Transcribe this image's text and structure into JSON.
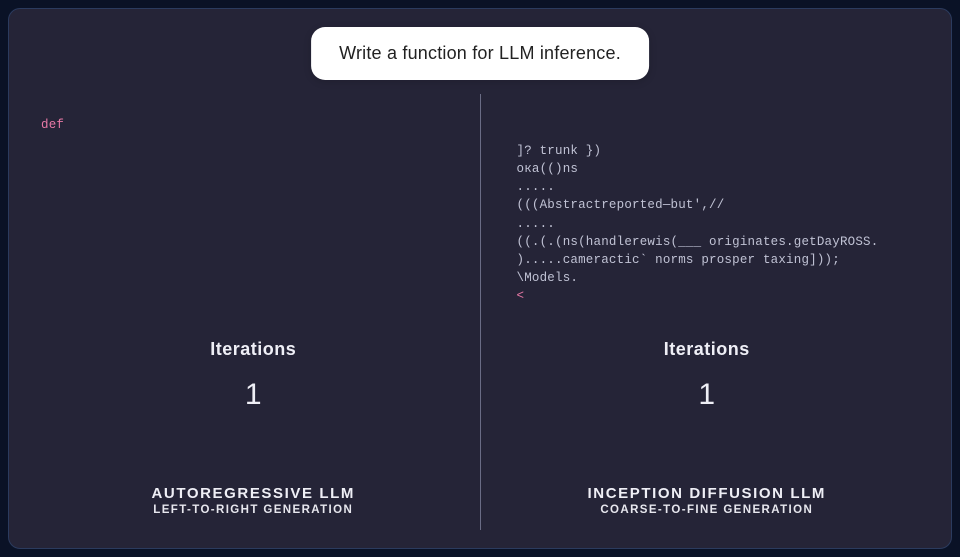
{
  "prompt": "Write a function for LLM inference.",
  "left": {
    "code": "def",
    "iterations_label": "Iterations",
    "iterations_value": "1",
    "title": "AUTOREGRESSIVE LLM",
    "subtitle": "LEFT-TO-RIGHT GENERATION"
  },
  "right": {
    "code_lines": [
      "]? trunk })",
      "ока(()ns",
      ".....",
      "(((Abstractreported—but',//",
      ".....",
      "((.(.(ns(handlerewis(___ originates.getDayROSS.",
      ").....cameractic` norms prosper taxing]));",
      "\\Models."
    ],
    "code_tail": "<",
    "iterations_label": "Iterations",
    "iterations_value": "1",
    "title": "INCEPTION DIFFUSION LLM",
    "subtitle": "COARSE-TO-FINE GENERATION"
  }
}
